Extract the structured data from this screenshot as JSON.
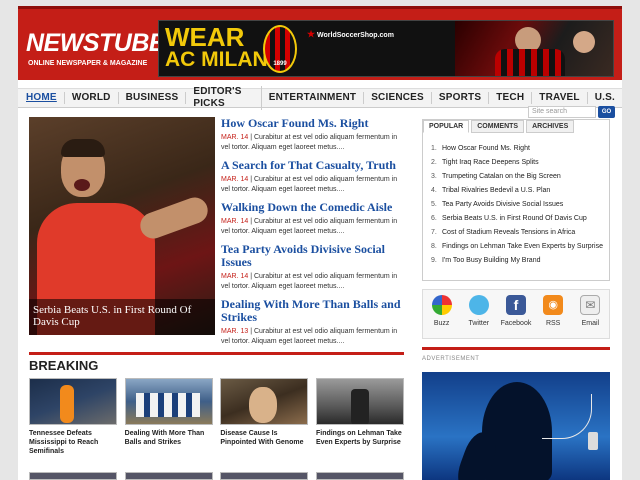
{
  "header": {
    "logo": "NEWSTUBE",
    "tagline": "ONLINE NEWSPAPER & MAGAZINE",
    "banner": {
      "line1": "WEAR",
      "line2": "AC MILAN",
      "crest_year": "1899",
      "shop": "WorldSoccerShop.com"
    }
  },
  "nav": [
    "HOME",
    "WORLD",
    "BUSINESS",
    "EDITOR'S PICKS",
    "ENTERTAINMENT",
    "SCIENCES",
    "SPORTS",
    "TECH",
    "TRAVEL",
    "U.S."
  ],
  "search": {
    "placeholder": "Site search",
    "button": "GO"
  },
  "featured": {
    "caption": "Serbia Beats U.S. in First Round Of Davis Cup"
  },
  "articles": [
    {
      "title": "How Oscar Found Ms. Right",
      "date": "MAR. 14",
      "excerpt": "| Curabitur at est vel odio aliquam fermentum in vel tortor. Aliquam eget laoreet metus...."
    },
    {
      "title": "A Search for That Casualty, Truth",
      "date": "MAR. 14",
      "excerpt": "| Curabitur at est vel odio aliquam fermentum in vel tortor. Aliquam eget laoreet metus...."
    },
    {
      "title": "Walking Down the Comedic Aisle",
      "date": "MAR. 14",
      "excerpt": "| Curabitur at est vel odio aliquam fermentum in vel tortor. Aliquam eget laoreet metus...."
    },
    {
      "title": "Tea Party Avoids Divisive Social Issues",
      "date": "MAR. 14",
      "excerpt": "| Curabitur at est vel odio aliquam fermentum in vel tortor. Aliquam eget laoreet metus...."
    },
    {
      "title": "Dealing With More Than Balls and Strikes",
      "date": "MAR. 13",
      "excerpt": "| Curabitur at est vel odio aliquam fermentum in vel tortor. Aliquam eget laoreet metus...."
    }
  ],
  "breaking": {
    "title": "BREAKING",
    "items": [
      {
        "title": "Tennessee Defeats Mississippi to Reach Semifinals"
      },
      {
        "title": "Dealing With More Than Balls and Strikes"
      },
      {
        "title": "Disease Cause Is Pinpointed With Genome"
      },
      {
        "title": "Findings on Lehman Take Even Experts by Surprise"
      }
    ]
  },
  "sidebar": {
    "tabs": [
      "POPULAR",
      "COMMENTS",
      "ARCHIVES"
    ],
    "popular": [
      "How Oscar Found Ms. Right",
      "Tight Iraq Race Deepens Splits",
      "Trumpeting Catalan on the Big Screen",
      "Tribal Rivalries Bedevil a U.S. Plan",
      "Tea Party Avoids Divisive Social Issues",
      "Serbia Beats U.S. in First Round Of Davis Cup",
      "Cost of Stadium Reveals Tensions in Africa",
      "Findings on Lehman Take Even Experts by Surprise",
      "I'm Too Busy Building My Brand"
    ],
    "social": [
      {
        "label": "Buzz",
        "icon": "buzz-icon"
      },
      {
        "label": "Twitter",
        "icon": "twitter-icon"
      },
      {
        "label": "Facebook",
        "icon": "facebook-icon",
        "glyph": "f"
      },
      {
        "label": "RSS",
        "icon": "rss-icon",
        "glyph": "◉"
      },
      {
        "label": "Email",
        "icon": "email-icon",
        "glyph": "✉"
      }
    ],
    "ad_label": "ADVERTISEMENT"
  },
  "colors": {
    "brand": "#c41e17",
    "link": "#1b4fa0"
  }
}
